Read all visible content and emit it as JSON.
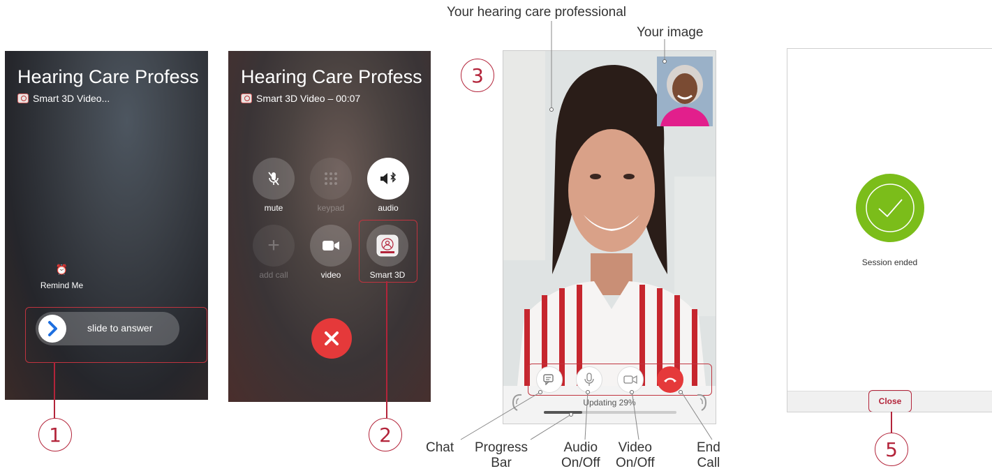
{
  "screen1": {
    "caller_name": "Hearing Care Profess",
    "subtitle": "Smart 3D Video...",
    "remind_label": "Remind Me",
    "remind_icon": "alarm-clock-icon",
    "slider_text": "slide to answer",
    "callout_number": "1"
  },
  "screen2": {
    "caller_name": "Hearing Care Profess",
    "subtitle": "Smart 3D Video – 00:07",
    "buttons": [
      {
        "label": "mute",
        "icon": "mic-off-icon"
      },
      {
        "label": "keypad",
        "icon": "keypad-icon"
      },
      {
        "label": "audio",
        "icon": "speaker-bluetooth-icon"
      },
      {
        "label": "add call",
        "icon": "plus-icon"
      },
      {
        "label": "video",
        "icon": "video-camera-icon"
      },
      {
        "label": "Smart 3D",
        "icon": "smart3d-app-icon"
      }
    ],
    "end_icon": "close-icon",
    "callout_number": "2"
  },
  "screen3": {
    "label_professional": "Your hearing care professional",
    "label_your_image": "Your image",
    "callout_number": "3",
    "progress_text": "Updating 29%",
    "progress_percent": 29,
    "controls": [
      {
        "name": "chat",
        "icon": "chat-icon"
      },
      {
        "name": "audio",
        "icon": "microphone-icon"
      },
      {
        "name": "video",
        "icon": "video-camera-icon"
      },
      {
        "name": "end",
        "icon": "phone-hangup-icon"
      }
    ],
    "legend": {
      "chat": "Chat",
      "progress": "Progress\nBar",
      "audio": "Audio\nOn/Off",
      "video": "Video\nOn/Off",
      "end": "End\nCall"
    }
  },
  "screen4": {
    "status_text": "Session ended",
    "close_label": "Close",
    "callout_number": "5"
  },
  "colors": {
    "accent": "#b3243a",
    "end_call_red": "#e5393a",
    "success_green": "#7bbd1a"
  }
}
